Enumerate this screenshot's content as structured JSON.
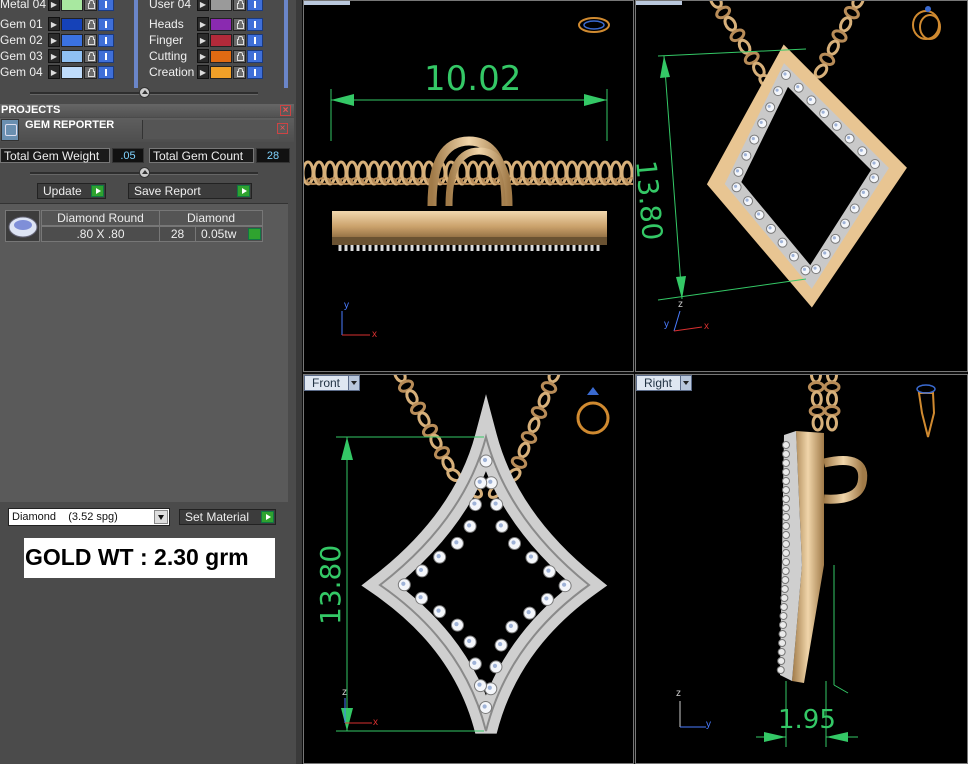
{
  "layers": {
    "left_column": [
      {
        "label": "Metal 04",
        "color": "#a8e8a0"
      },
      {
        "label": "Gem 01",
        "color": "#1542b8"
      },
      {
        "label": "Gem 02",
        "color": "#3b72e0"
      },
      {
        "label": "Gem 03",
        "color": "#8fc0f2"
      },
      {
        "label": "Gem 04",
        "color": "#bfdcfb"
      }
    ],
    "right_column": [
      {
        "label": "User 04",
        "color": "#9a9a9a"
      },
      {
        "label": "Heads",
        "color": "#8a2ab0"
      },
      {
        "label": "Finger",
        "color": "#b22a3a"
      },
      {
        "label": "Cutting",
        "color": "#e06a12"
      },
      {
        "label": "Creation",
        "color": "#f0a028"
      }
    ]
  },
  "projects": {
    "title": "PROJECTS"
  },
  "gem_reporter": {
    "title": "GEM REPORTER",
    "total_weight_label": "Total Gem Weight",
    "total_weight_value": ".05",
    "total_count_label": "Total Gem Count",
    "total_count_value": "28",
    "update_label": "Update",
    "save_report_label": "Save Report",
    "table": {
      "headers": [
        "Diamond Round",
        "Diamond"
      ],
      "row": {
        "size": ".80 X .80",
        "count": "28",
        "weight": "0.05tw"
      }
    }
  },
  "material": {
    "selected": "Diamond    (3.52 spg)",
    "set_material_label": "Set Material"
  },
  "gold_weight": "GOLD WT : 2.30 grm",
  "viewports": {
    "top_left": {
      "dimension": "10.02",
      "axis_y": "y",
      "axis_x": "x"
    },
    "top_right": {
      "dimension": "13.80",
      "axis_z": "z",
      "axis_y": "y",
      "axis_x": "x"
    },
    "front": {
      "label": "Front",
      "dimension": "13.80",
      "axis_z": "z",
      "axis_x": "x"
    },
    "right": {
      "label": "Right",
      "dimension": "1.95",
      "axis_z": "z",
      "axis_y": "y"
    }
  },
  "colors": {
    "dimension_green": "#34c866",
    "gold": "#d7b07a",
    "axis_red": "#d93030",
    "axis_blue": "#4a7cff"
  }
}
